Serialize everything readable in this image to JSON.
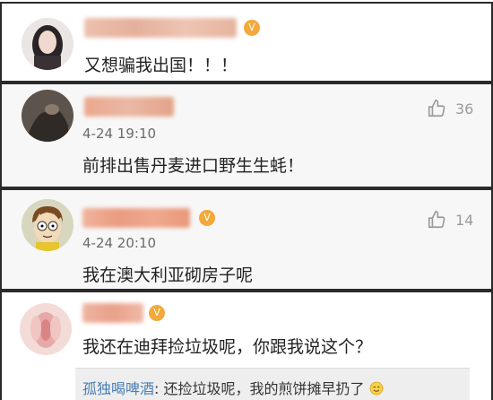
{
  "comments": [
    {
      "text": "又想骗我出国！！！",
      "time": "",
      "likes": "",
      "avatar_icon": "girl-portrait-avatar",
      "username_color": "#e9b9a6"
    },
    {
      "text": "前排出售丹麦进口野生生蚝！",
      "time": "4-24 19:10",
      "likes": "36",
      "avatar_icon": "dark-photo-avatar",
      "username_color": "#e6a98f"
    },
    {
      "text": "我在澳大利亚砌房子呢",
      "time": "4-24 20:10",
      "likes": "14",
      "avatar_icon": "cartoon-boy-avatar",
      "username_color": "#eba488"
    },
    {
      "text": "我还在迪拜捡垃圾呢，你跟我说这个？",
      "time": "",
      "likes": "",
      "avatar_icon": "pink-flower-avatar",
      "username_color": "#e7a78e",
      "reply": {
        "user": "孤独喝啤酒",
        "separator": ": ",
        "text": "还捡垃圾呢，我的煎饼摊早扔了",
        "emoji_icon": "sly-smile-emoji"
      }
    }
  ],
  "colors": {
    "border": "#2a2a2a",
    "link": "#4a7fb5",
    "vip_badge": "#f3a93b"
  }
}
